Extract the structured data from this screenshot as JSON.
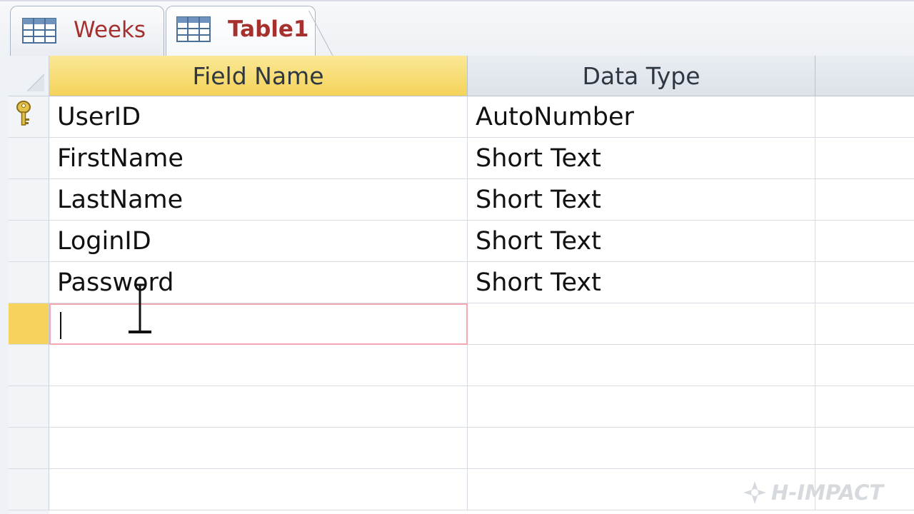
{
  "tabs": [
    {
      "label": "Weeks",
      "icon": "table-icon",
      "active": false
    },
    {
      "label": "Table1",
      "icon": "table-icon",
      "active": true
    }
  ],
  "grid": {
    "headers": {
      "field_name": "Field Name",
      "data_type": "Data Type",
      "description": ""
    },
    "rows": [
      {
        "field_name": "UserID",
        "data_type": "AutoNumber",
        "primary_key": true
      },
      {
        "field_name": "FirstName",
        "data_type": "Short Text"
      },
      {
        "field_name": "LastName",
        "data_type": "Short Text"
      },
      {
        "field_name": "LoginID",
        "data_type": "Short Text"
      },
      {
        "field_name": "Password",
        "data_type": "Short Text"
      },
      {
        "field_name": "",
        "data_type": "",
        "current": true
      },
      {
        "field_name": "",
        "data_type": ""
      },
      {
        "field_name": "",
        "data_type": ""
      },
      {
        "field_name": "",
        "data_type": ""
      },
      {
        "field_name": "",
        "data_type": ""
      }
    ]
  },
  "watermark": {
    "text": "H-IMPACT"
  },
  "colors": {
    "header_active": "#f4d35a",
    "tab_text": "#a5302d",
    "current_row_border": "#f3a8b3"
  }
}
